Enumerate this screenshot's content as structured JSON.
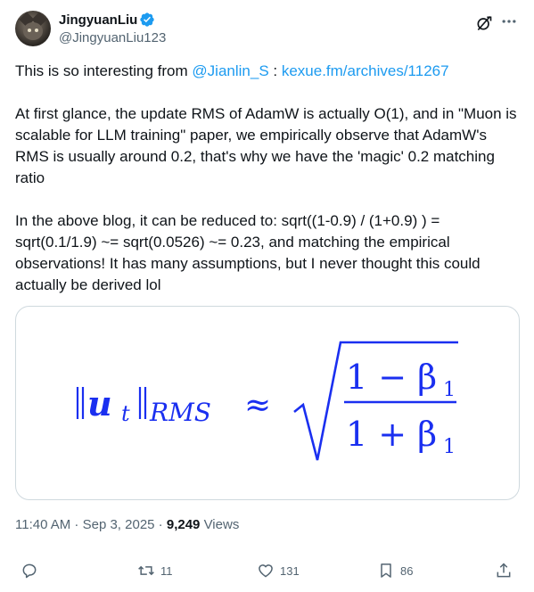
{
  "author": {
    "display_name": "JingyuanLiu",
    "handle": "@JingyuanLiu123",
    "verified": true
  },
  "tweet": {
    "p1_prefix": "This is so interesting from ",
    "p1_mention": "@Jianlin_S",
    "p1_sep": " : ",
    "p1_link": "kexue.fm/archives/11267",
    "p2": "At first glance, the update RMS of AdamW is actually O(1), and in \"Muon is scalable for LLM training\" paper, we empirically observe that AdamW's RMS is usually around 0.2, that's why we have the 'magic' 0.2 matching ratio",
    "p3": "In the above blog, it can be reduced to: sqrt((1-0.9) / (1+0.9) ) = sqrt(0.1/1.9) ~= sqrt(0.0526) ~= 0.23, and matching the empirical observations! It has many assumptions, but I never thought this could actually be derived lol"
  },
  "media": {
    "formula_lhs_norm": "u",
    "formula_lhs_sub": "t",
    "formula_lhs_rms": "RMS",
    "formula_approx": "≈",
    "formula_num": "1 − β",
    "formula_den": "1 + β",
    "formula_beta_sub": "1",
    "formula_color": "#1a2ff0"
  },
  "meta": {
    "time": "11:40 AM",
    "dot1": " · ",
    "date": "Sep 3, 2025",
    "dot2": " · ",
    "views_count": "9,249",
    "views_label": " Views"
  },
  "actions": {
    "reply_count": "",
    "retweet_count": "11",
    "like_count": "131",
    "bookmark_count": "86"
  },
  "icons": {
    "reply": "reply-icon",
    "retweet": "retweet-icon",
    "like": "heart-icon",
    "bookmark": "bookmark-icon",
    "share": "share-icon",
    "more": "more-icon",
    "grok": "grok-icon",
    "verified": "verified-badge-icon"
  },
  "colors": {
    "link": "#1d9bf0",
    "text": "#0f1419",
    "secondary": "#536471",
    "verified": "#1d9bf0"
  }
}
